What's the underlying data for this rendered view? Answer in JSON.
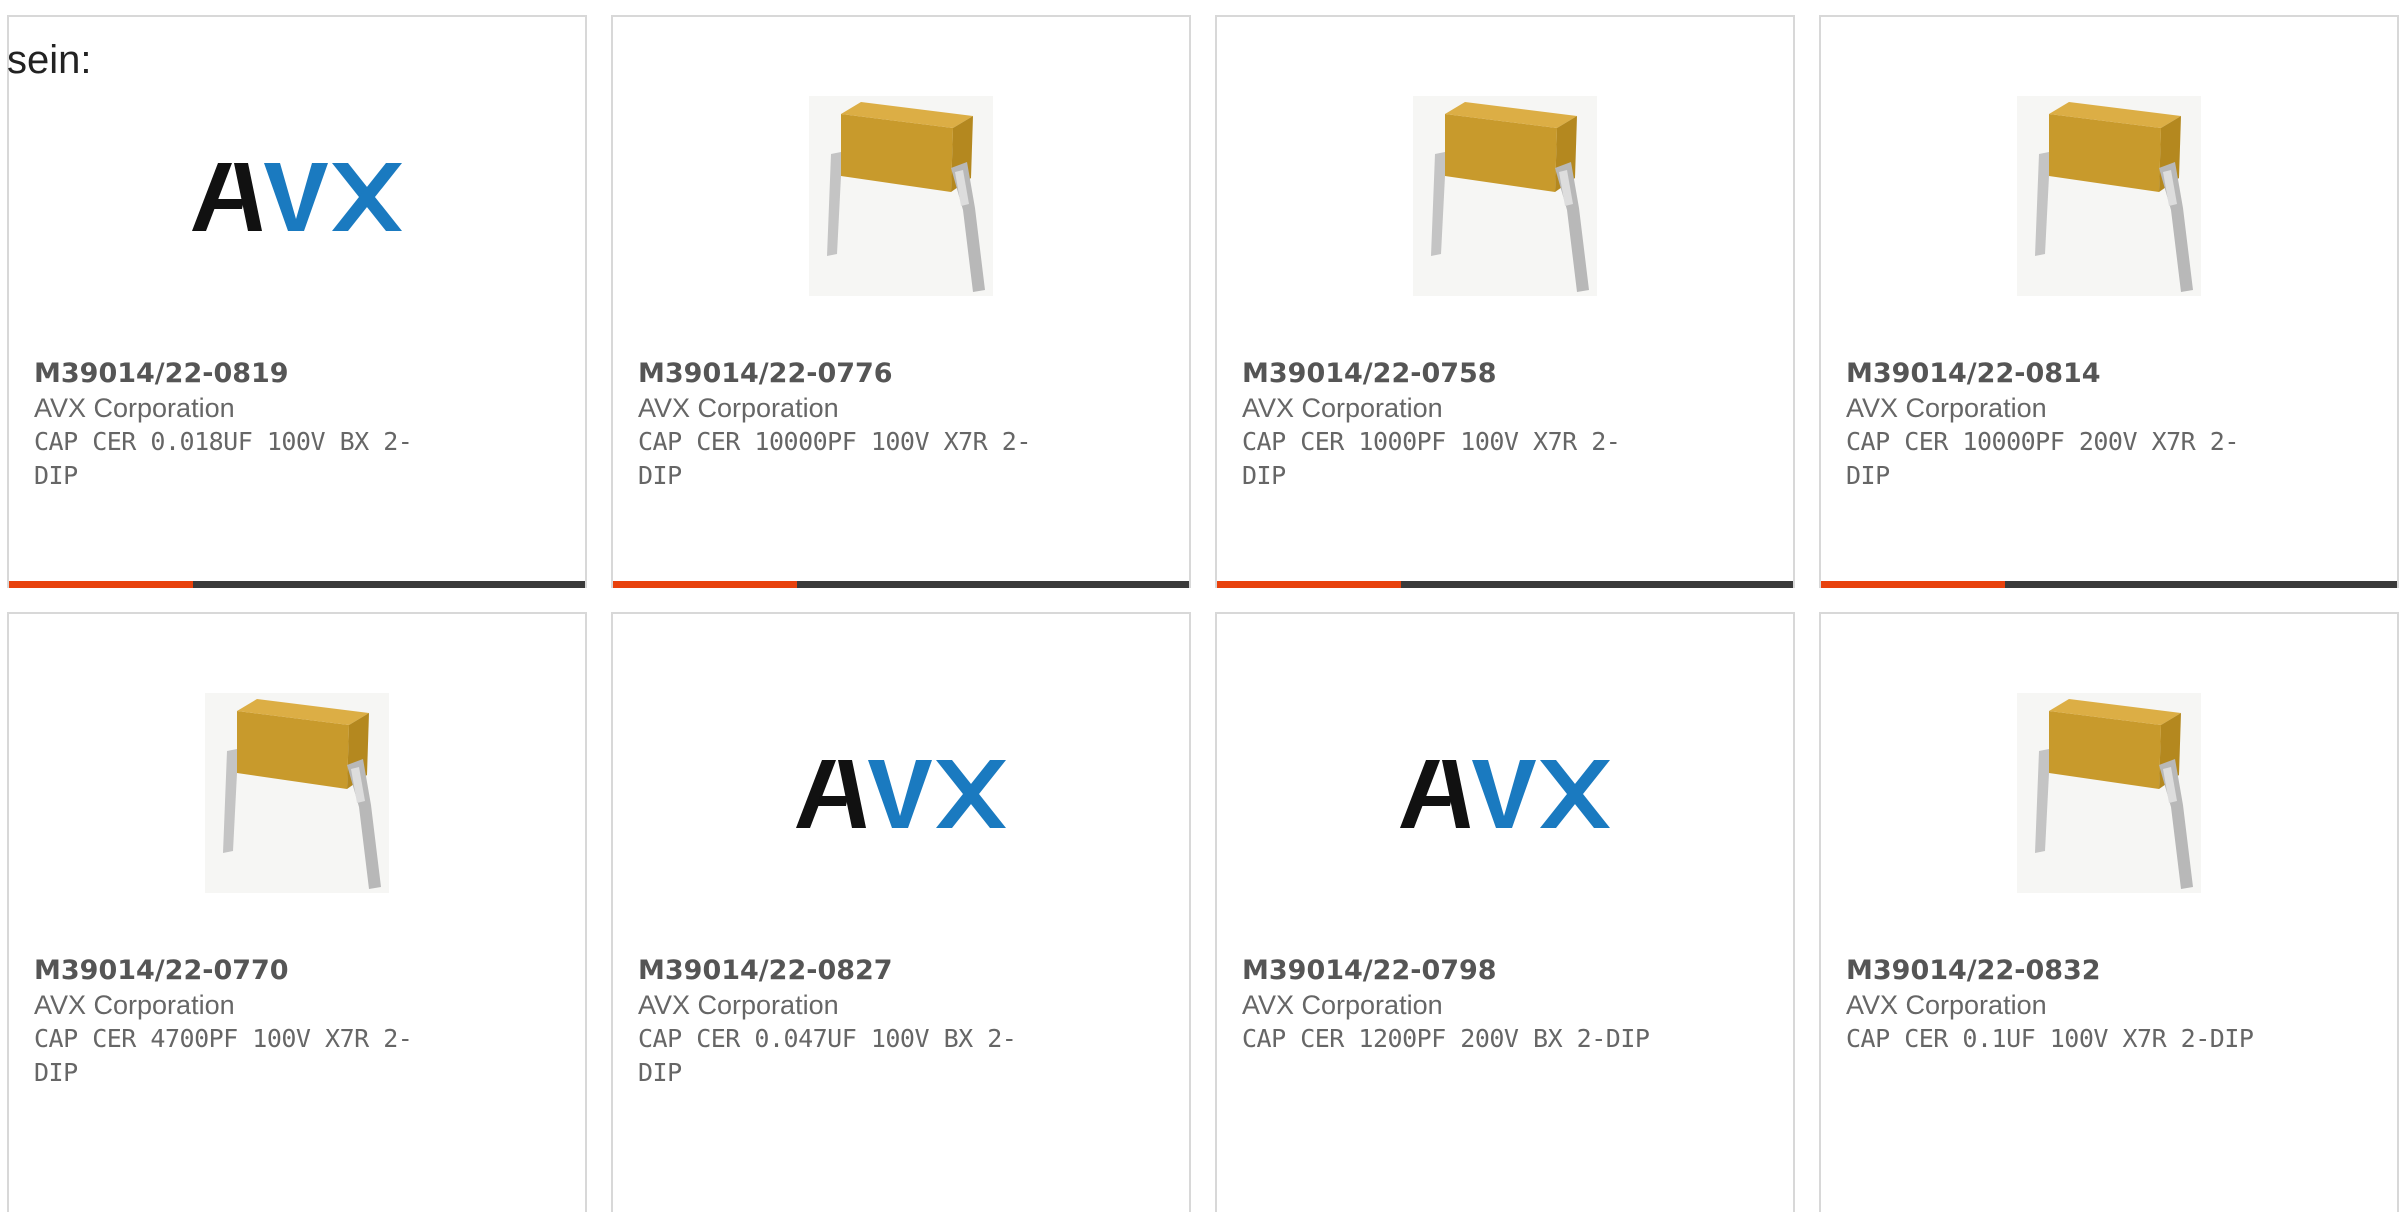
{
  "intro_text": "sein:",
  "colors": {
    "accent": "#e8410c",
    "bar_dark": "#3a3a3a",
    "border": "#d8d8d8",
    "avx_black": "#111111",
    "avx_blue": "#1a7ac0"
  },
  "accent_progress": 0.32,
  "products": [
    {
      "part_number": "M39014/22-0819",
      "manufacturer": "AVX Corporation",
      "description": "CAP CER 0.018UF 100V BX 2-DIP",
      "image": "avx-logo"
    },
    {
      "part_number": "M39014/22-0776",
      "manufacturer": "AVX Corporation",
      "description": "CAP CER 10000PF 100V X7R 2-DIP",
      "image": "capacitor-photo"
    },
    {
      "part_number": "M39014/22-0758",
      "manufacturer": "AVX Corporation",
      "description": "CAP CER 1000PF 100V X7R 2-DIP",
      "image": "capacitor-photo"
    },
    {
      "part_number": "M39014/22-0814",
      "manufacturer": "AVX Corporation",
      "description": "CAP CER 10000PF 200V X7R 2-DIP",
      "image": "capacitor-photo"
    },
    {
      "part_number": "M39014/22-0770",
      "manufacturer": "AVX Corporation",
      "description": "CAP CER 4700PF 100V X7R 2-DIP",
      "image": "capacitor-photo"
    },
    {
      "part_number": "M39014/22-0827",
      "manufacturer": "AVX Corporation",
      "description": "CAP CER 0.047UF 100V BX 2-DIP",
      "image": "avx-logo"
    },
    {
      "part_number": "M39014/22-0798",
      "manufacturer": "AVX Corporation",
      "description": "CAP CER 1200PF 200V BX 2-DIP",
      "image": "avx-logo"
    },
    {
      "part_number": "M39014/22-0832",
      "manufacturer": "AVX Corporation",
      "description": "CAP CER 0.1UF 100V X7R 2-DIP",
      "image": "capacitor-photo"
    }
  ]
}
